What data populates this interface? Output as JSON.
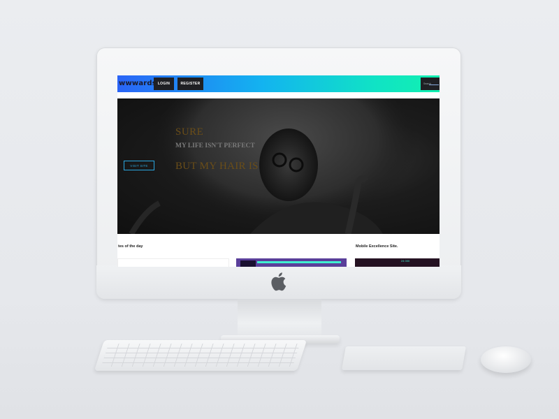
{
  "site": {
    "brand": "wwwards!!",
    "nav": {
      "login": "LOGIN",
      "register": "REGISTER",
      "search": "Search"
    }
  },
  "hero": {
    "headline_1": "SURE",
    "headline_2": "MY LIFE ISN'T PERFECT",
    "headline_3": "BUT MY HAIR IS",
    "cta": "VISIT SITE"
  },
  "sections": {
    "sites_of_the_day": "tes of the day",
    "mobile_excellence": "Mobile Excellence Site."
  },
  "cards": {
    "card3_number": "24 000"
  },
  "colors": {
    "gradient_start": "#2a64f6",
    "gradient_end": "#12f0b0",
    "accent_gold": "#6b4e18",
    "accent_blue": "#2aa7e0"
  },
  "icons": [
    "apple-logo-icon"
  ]
}
